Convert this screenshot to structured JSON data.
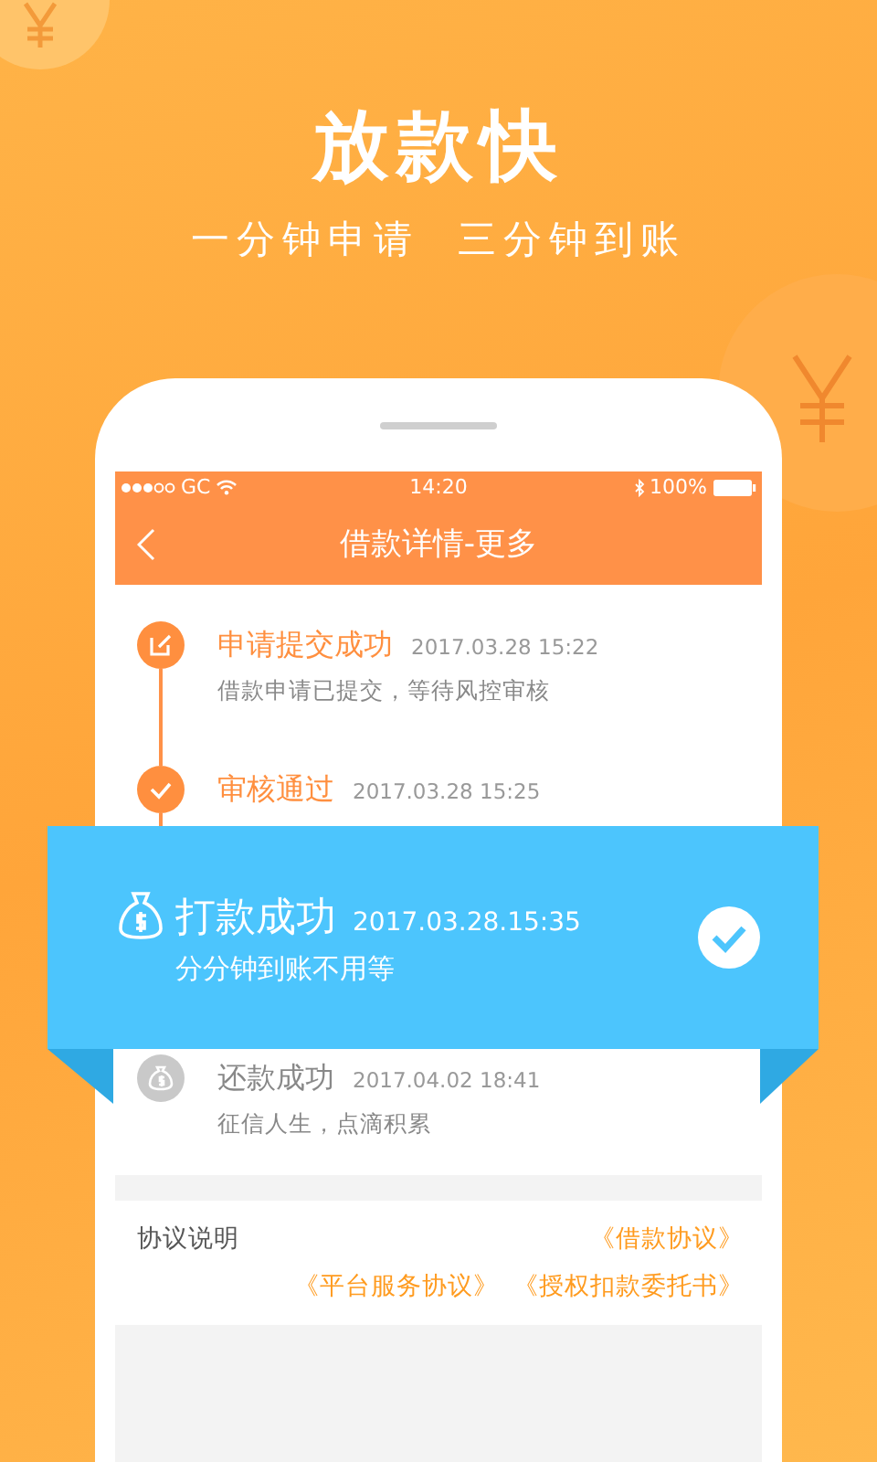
{
  "headline": "放款快",
  "subheadline": "一分钟申请  三分钟到账",
  "status_bar": {
    "carrier": "GC",
    "time": "14:20",
    "battery": "100%"
  },
  "nav": {
    "title": "借款详情-更多"
  },
  "steps": [
    {
      "title": "申请提交成功",
      "time": "2017.03.28 15:22",
      "description": "借款申请已提交，等待风控审核",
      "done": true,
      "kind": "edit"
    },
    {
      "title": "审核通过",
      "time": "2017.03.28 15:25",
      "done": true,
      "kind": "check"
    },
    {
      "title": "还款成功",
      "time": "2017.04.02 18:41",
      "description": "征信人生，点滴积累",
      "done": false,
      "kind": "money"
    }
  ],
  "banner": {
    "title": "打款成功",
    "time": "2017.03.28.15:35",
    "subtitle": "分分钟到账不用等"
  },
  "agreements": {
    "label": "协议说明",
    "links": [
      "《借款协议》",
      "《平台服务协议》",
      "《授权扣款委托书》"
    ]
  }
}
